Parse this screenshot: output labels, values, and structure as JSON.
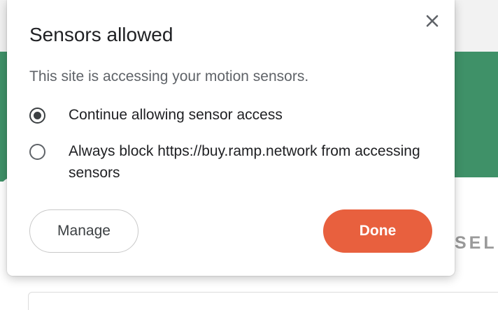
{
  "dialog": {
    "title": "Sensors allowed",
    "message": "This site is accessing your motion sensors.",
    "options": [
      {
        "label": "Continue allowing sensor access",
        "checked": true
      },
      {
        "label": "Always block https://buy.ramp.network from accessing sensors",
        "checked": false
      }
    ],
    "manage_label": "Manage",
    "done_label": "Done",
    "close_icon": "close-icon"
  },
  "background": {
    "partial_text": "SELL",
    "header_color": "#3f9168"
  },
  "colors": {
    "done_button": "#e8603e",
    "text_primary": "#202124",
    "text_secondary": "#5f6368"
  }
}
